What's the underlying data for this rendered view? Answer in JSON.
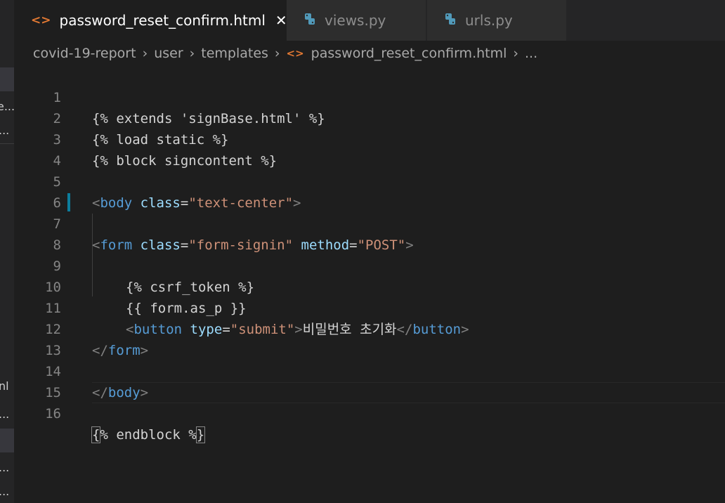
{
  "left_strip": {
    "frag1": "e...",
    "frag2": "...",
    "frag3": "nl",
    "frag4": "...",
    "frag5": "...",
    "frag6": "..."
  },
  "tabs": [
    {
      "label": "password_reset_confirm.html",
      "icon": "html-icon",
      "active": true
    },
    {
      "label": "views.py",
      "icon": "python-icon",
      "active": false
    },
    {
      "label": "urls.py",
      "icon": "python-icon",
      "active": false
    }
  ],
  "breadcrumb": {
    "items": [
      "covid-19-report",
      "user",
      "templates",
      "password_reset_confirm.html",
      "..."
    ],
    "file_icon": "html-icon"
  },
  "editor": {
    "line_numbers": [
      "1",
      "2",
      "3",
      "4",
      "5",
      "6",
      "7",
      "8",
      "9",
      "10",
      "11",
      "12",
      "13",
      "14",
      "15",
      "16"
    ],
    "lines": {
      "l1": "{% extends 'signBase.html' %}",
      "l2": "{% load static %}",
      "l3": "{% block signcontent %}",
      "l5": {
        "open": "<",
        "tag": "body",
        "attr": "class",
        "eq": "=",
        "val": "\"text-center\"",
        "close": ">"
      },
      "l7": {
        "open": "<",
        "tag": "form",
        "attr1": "class",
        "val1": "\"form-signin\"",
        "attr2": "method",
        "val2": "\"POST\"",
        "close": ">"
      },
      "l9": "{% csrf_token %}",
      "l10": "{{ form.as_p }}",
      "l11": {
        "open": "<",
        "tag": "button",
        "attr": "type",
        "val": "\"submit\"",
        "close": ">",
        "text": "비밀번호 초기화",
        "end_open": "</",
        "end_tag": "button",
        "end_close": ">"
      },
      "l12": {
        "open": "</",
        "tag": "form",
        "close": ">"
      },
      "l14": {
        "open": "</",
        "tag": "body",
        "close": ">"
      },
      "l16": {
        "b1": "{",
        "mid": "% endblock %",
        "b2": "}"
      }
    }
  },
  "colors": {
    "tag": "#569cd6",
    "attr": "#9cdcfe",
    "string": "#ce9178",
    "punct": "#808080",
    "html_icon": "#e37933",
    "python_icon": "#519aba"
  }
}
